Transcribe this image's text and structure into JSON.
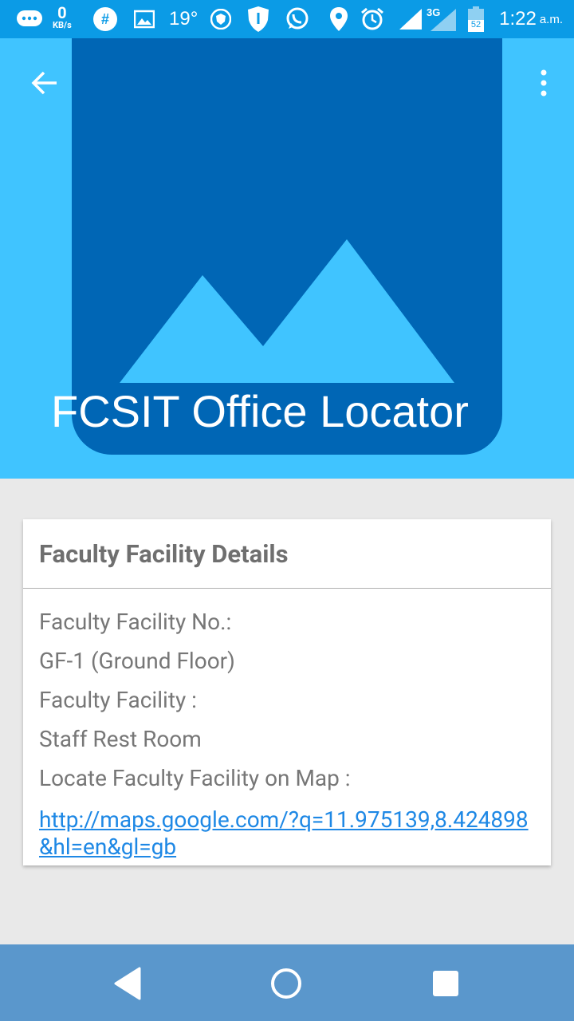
{
  "status_bar": {
    "speed_value": "0",
    "speed_unit": "KB/s",
    "temperature": "19°",
    "network": "3G",
    "battery": "52",
    "time": "1:22",
    "ampm": "a.m."
  },
  "header": {
    "title": "FCSIT Office Locator"
  },
  "card": {
    "title": "Faculty Facility Details",
    "facility_no_label": "Faculty Facility No.:",
    "facility_no_value": "GF-1 (Ground Floor)",
    "facility_label": "Faculty Facility :",
    "facility_value": "Staff Rest Room",
    "map_label": "Locate Faculty Facility on Map :",
    "map_link": "http://maps.google.com/?q=11.975139,8.424898&hl=en&gl=gb"
  },
  "colors": {
    "status_bar": "#0b9be6",
    "header_bg": "#40c4ff",
    "hero_bg": "#0066b5",
    "link": "#1e88e5",
    "nav_bar": "#5a97cc"
  }
}
